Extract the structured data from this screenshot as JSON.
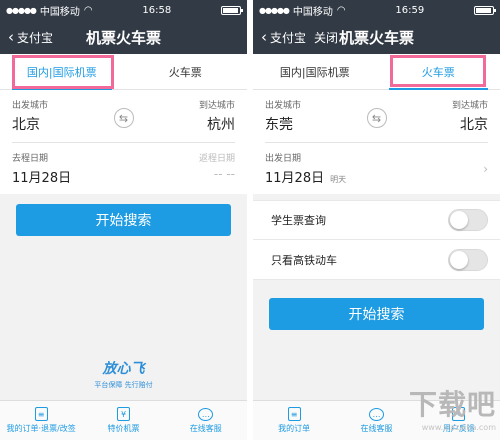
{
  "left": {
    "status": {
      "carrier": "中国移动",
      "time": "16:58"
    },
    "nav": {
      "back": "支付宝",
      "title": "机票火车票"
    },
    "tabs": [
      "国内|国际机票",
      "火车票"
    ],
    "from": {
      "label": "出发城市",
      "city": "北京"
    },
    "to": {
      "label": "到达城市",
      "city": "杭州"
    },
    "depart": {
      "label": "去程日期",
      "date": "11月28日"
    },
    "return": {
      "label": "返程日期",
      "value": "-- --"
    },
    "search_button": "开始搜索",
    "logo": {
      "mark": "放心飞",
      "sub": "平台保障 先行赔付"
    },
    "bottom": [
      {
        "icon": "order-icon",
        "label": "我的订单·退票/改签"
      },
      {
        "icon": "discount-ticket-icon",
        "label": "特价机票"
      },
      {
        "icon": "chat-icon",
        "label": "在线客服"
      }
    ]
  },
  "right": {
    "status": {
      "carrier": "中国移动",
      "time": "16:59"
    },
    "nav": {
      "back": "支付宝",
      "close": "关闭",
      "title": "机票火车票"
    },
    "tabs": [
      "国内|国际机票",
      "火车票"
    ],
    "from": {
      "label": "出发城市",
      "city": "东莞"
    },
    "to": {
      "label": "到达城市",
      "city": "北京"
    },
    "depart": {
      "label": "出发日期",
      "date": "11月28日",
      "note": "明天"
    },
    "toggles": [
      {
        "label": "学生票查询",
        "on": false
      },
      {
        "label": "只看高铁动车",
        "on": false
      }
    ],
    "search_button": "开始搜索",
    "bottom": [
      {
        "icon": "order-icon",
        "label": "我的订单"
      },
      {
        "icon": "chat-icon",
        "label": "在线客服"
      },
      {
        "icon": "feedback-icon",
        "label": "用户反馈"
      }
    ]
  },
  "watermark": {
    "main": "下载吧",
    "sub": "www.xiazaiba.com"
  },
  "colors": {
    "accent": "#1d9be3",
    "navbar": "#323a45",
    "highlight": "#f26a9a"
  }
}
